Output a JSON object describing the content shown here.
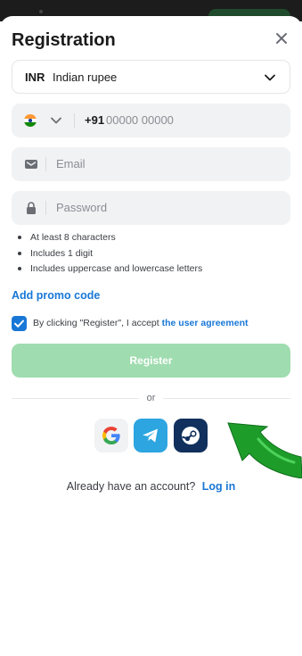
{
  "header": {
    "title": "Registration",
    "close_icon": "close-icon"
  },
  "currency": {
    "code": "INR",
    "name": "Indian rupee"
  },
  "phone": {
    "country_code": "+91",
    "placeholder": "00000 00000",
    "flag": "india-flag-icon"
  },
  "email": {
    "placeholder": "Email"
  },
  "password": {
    "placeholder": "Password"
  },
  "password_rules": [
    "At least 8 characters",
    "Includes 1 digit",
    "Includes uppercase and lowercase letters"
  ],
  "promo": {
    "label": "Add promo code"
  },
  "agreement": {
    "checked": true,
    "text": "By clicking \"Register\", I accept",
    "link": "the user agreement"
  },
  "register": {
    "label": "Register"
  },
  "divider": {
    "label": "or"
  },
  "social": [
    "google-icon",
    "telegram-icon",
    "steam-icon"
  ],
  "login": {
    "prompt": "Already have an account?",
    "link": "Log in"
  },
  "colors": {
    "accent": "#1877d6",
    "register_button": "#9fdcaf",
    "arrow": "#1e9c2a"
  }
}
